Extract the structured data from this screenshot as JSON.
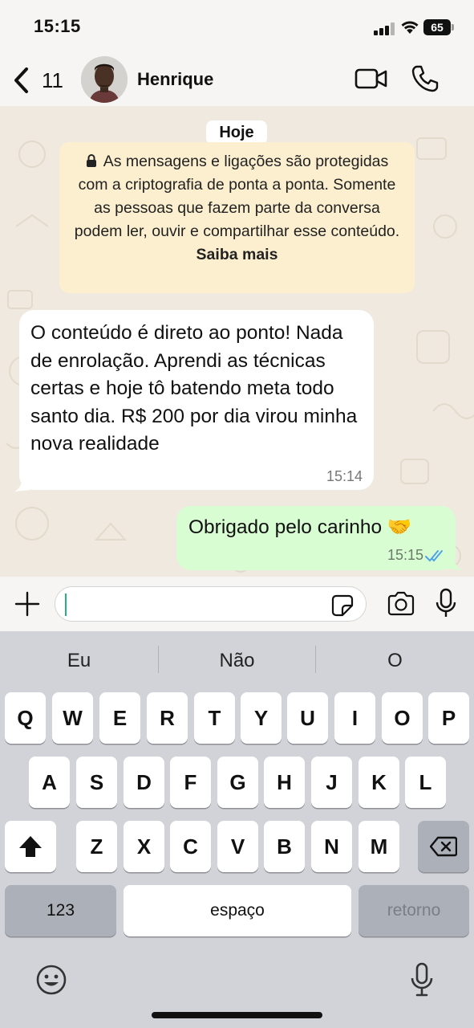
{
  "status_bar": {
    "time": "15:15",
    "battery": "65"
  },
  "header": {
    "back_count": "11",
    "contact_name": "Henrique"
  },
  "chat": {
    "date_chip": "Hoje",
    "encryption_notice": {
      "text": "As mensagens e ligações são protegidas com a criptografia de ponta a ponta. Somente as pessoas que fazem parte da conversa podem ler, ouvir e compartilhar esse conteúdo.",
      "link": "Saiba mais"
    },
    "messages": [
      {
        "direction": "incoming",
        "text": "O conteúdo é direto ao ponto! Nada de enrolação. Aprendi as técnicas certas e hoje tô batendo meta todo santo dia. R$ 200 por dia virou minha nova realidade",
        "time": "15:14"
      },
      {
        "direction": "outgoing",
        "text": "Obrigado pelo carinho 🤝",
        "time": "15:15",
        "status": "read"
      }
    ]
  },
  "input": {
    "value": "",
    "icons": [
      "plus-icon",
      "sticker-icon",
      "camera-icon",
      "mic-icon"
    ]
  },
  "keyboard": {
    "suggestions": [
      "Eu",
      "Não",
      "O"
    ],
    "row1": [
      "Q",
      "W",
      "E",
      "R",
      "T",
      "Y",
      "U",
      "I",
      "O",
      "P"
    ],
    "row2": [
      "A",
      "S",
      "D",
      "F",
      "G",
      "H",
      "J",
      "K",
      "L"
    ],
    "row3": [
      "Z",
      "X",
      "C",
      "V",
      "B",
      "N",
      "M"
    ],
    "numbers_key": "123",
    "space_key": "espaço",
    "return_key": "retorno",
    "icons": [
      "shift-icon",
      "backspace-icon",
      "emoji-icon",
      "dictation-mic-icon"
    ]
  },
  "colors": {
    "outgoing_bubble": "#d9fdd3",
    "incoming_bubble": "#ffffff",
    "notice_bg": "#fcefcf",
    "read_ticks": "#4fa3e8",
    "caret": "#24b37a"
  }
}
